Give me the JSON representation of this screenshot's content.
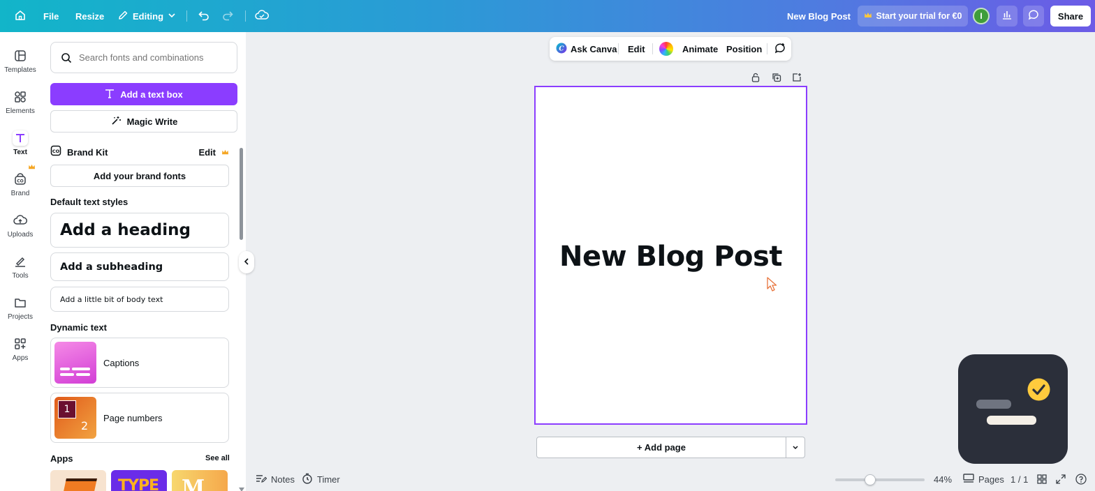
{
  "topbar": {
    "file": "File",
    "resize": "Resize",
    "editing": "Editing",
    "doc_title": "New Blog Post",
    "trial": "Start your trial for €0",
    "avatar_initial": "I",
    "share": "Share"
  },
  "rail": {
    "items": [
      {
        "label": "Templates"
      },
      {
        "label": "Elements"
      },
      {
        "label": "Text"
      },
      {
        "label": "Brand"
      },
      {
        "label": "Uploads"
      },
      {
        "label": "Tools"
      },
      {
        "label": "Projects"
      },
      {
        "label": "Apps"
      }
    ]
  },
  "panel": {
    "search_placeholder": "Search fonts and combinations",
    "add_text_box": "Add a text box",
    "magic_write": "Magic Write",
    "brand_kit": "Brand Kit",
    "brand_kit_edit": "Edit",
    "add_brand_fonts": "Add your brand fonts",
    "default_styles_title": "Default text styles",
    "heading": "Add a heading",
    "subheading": "Add a subheading",
    "body": "Add a little bit of body text",
    "dynamic_title": "Dynamic text",
    "captions": "Captions",
    "page_numbers": "Page numbers",
    "apps_title": "Apps",
    "see_all": "See all"
  },
  "float_toolbar": {
    "ask_canva": "Ask Canva",
    "edit": "Edit",
    "animate": "Animate",
    "position": "Position"
  },
  "canvas": {
    "heading": "New Blog Post",
    "add_page": "+ Add page"
  },
  "bottom": {
    "notes": "Notes",
    "timer": "Timer",
    "zoom": "44%",
    "zoom_level": 0.44,
    "pages": "Pages",
    "page_count": "1 / 1"
  },
  "colors": {
    "accent": "#8b3dff",
    "topbar_start": "#12b5c9",
    "topbar_end": "#6c5be6"
  }
}
